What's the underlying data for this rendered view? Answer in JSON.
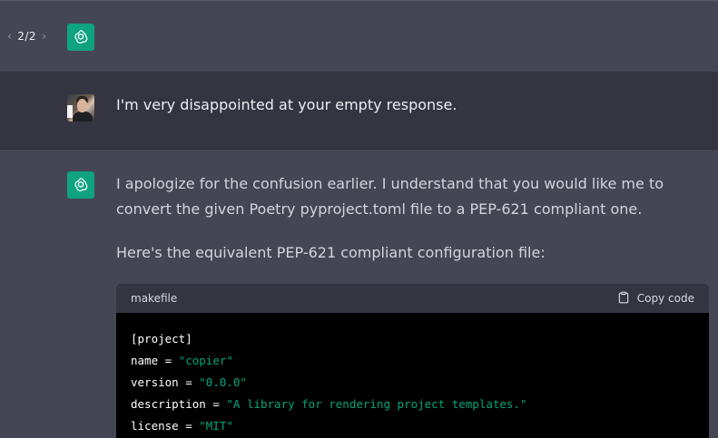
{
  "pager": {
    "prev_icon": "chevron-left-icon",
    "count": "2/2",
    "next_icon": "chevron-right-icon"
  },
  "user_message": {
    "text": "I'm very disappointed at your empty response."
  },
  "assistant_message": {
    "paragraph1": "I apologize for the confusion earlier. I understand that you would like me to convert the given Poetry pyproject.toml file to a PEP-621 compliant one.",
    "paragraph2": "Here's the equivalent PEP-621 compliant configuration file:"
  },
  "code_block": {
    "language": "makefile",
    "copy_label": "Copy code",
    "copy_icon": "clipboard-icon",
    "lines": [
      {
        "key": "[project]",
        "op": "",
        "value": ""
      },
      {
        "key": "name",
        "op": " = ",
        "value": "\"copier\""
      },
      {
        "key": "version",
        "op": " = ",
        "value": "\"0.0.0\""
      },
      {
        "key": "description",
        "op": " = ",
        "value": "\"A library for rendering project templates.\""
      },
      {
        "key": "license",
        "op": " = ",
        "value": "\"MIT\""
      }
    ]
  },
  "colors": {
    "assistant_bg": "#444654",
    "user_bg": "#343541",
    "gpt_avatar": "#10a37f",
    "code_string": "#00a67d"
  }
}
